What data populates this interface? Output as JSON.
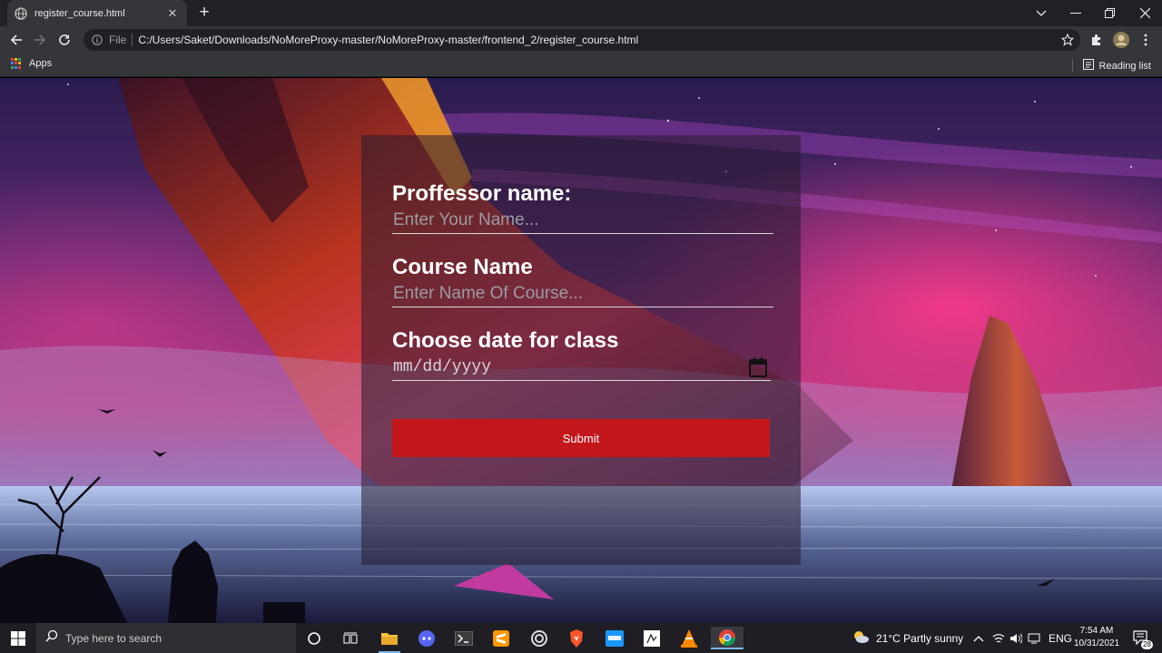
{
  "browser": {
    "tab_title": "register_course.html",
    "url_scheme": "File",
    "url": "C:/Users/Saket/Downloads/NoMoreProxy-master/NoMoreProxy-master/frontend_2/register_course.html",
    "bookmarks": {
      "apps_label": "Apps",
      "reading_list_label": "Reading list"
    },
    "icons": [
      "back-icon",
      "forward-icon",
      "reload-icon",
      "info-icon",
      "star-icon",
      "extensions-icon",
      "profile-avatar",
      "menu-icon"
    ]
  },
  "form": {
    "professor_label": "Proffessor name:",
    "professor_placeholder": "Enter Your Name...",
    "course_label": "Course Name",
    "course_placeholder": "Enter Name Of Course...",
    "date_label": "Choose date for class",
    "date_value": "mm/dd/yyyy",
    "submit_label": "Submit",
    "submit_color": "#c4171b"
  },
  "taskbar": {
    "search_placeholder": "Type here to search",
    "weather": "21°C  Partly sunny",
    "language": "ENG",
    "time": "7:54 AM",
    "date": "10/31/2021",
    "notification_count": "28"
  }
}
